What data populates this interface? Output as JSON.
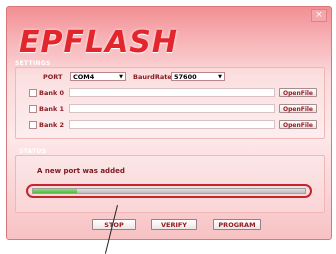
{
  "window": {
    "title": "EPFLASH",
    "close_label": "×"
  },
  "settings": {
    "section_label": "SETTINGS",
    "port_label": "PORT",
    "port_value": "COM4",
    "baud_label": "BaurdRate",
    "baud_value": "57600",
    "banks": [
      {
        "label": "Bank 0",
        "value": "",
        "button": "OpenFile"
      },
      {
        "label": "Bank 1",
        "value": "",
        "button": "OpenFile"
      },
      {
        "label": "Bank 2",
        "value": "",
        "button": "OpenFile"
      }
    ]
  },
  "status": {
    "section_label": "STATUS",
    "message": "A new port was added",
    "progress_fraction": 0.16
  },
  "actions": {
    "stop": "STOP",
    "verify": "VERIFY",
    "program": "PROGRAM"
  },
  "colors": {
    "accent": "#e3262c",
    "progress": "#5cc348",
    "highlight_ring": "#c4262c"
  }
}
